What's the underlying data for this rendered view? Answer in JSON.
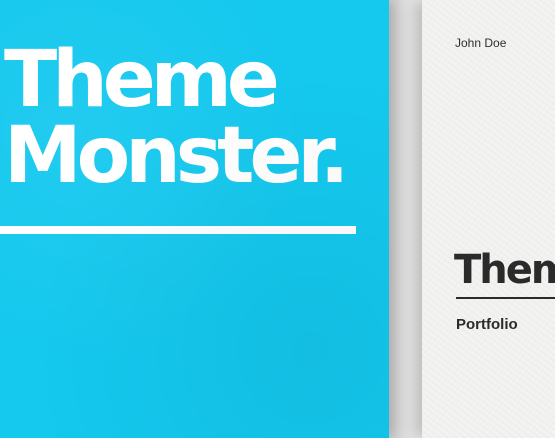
{
  "blue_card": {
    "title_line1": "Theme",
    "title_line2": "Monster.",
    "background_color": "#14c8ee"
  },
  "white_card": {
    "author": "John Doe",
    "title": "Theme",
    "subtitle": "Portfolio",
    "background_color": "#f3f3f1"
  }
}
